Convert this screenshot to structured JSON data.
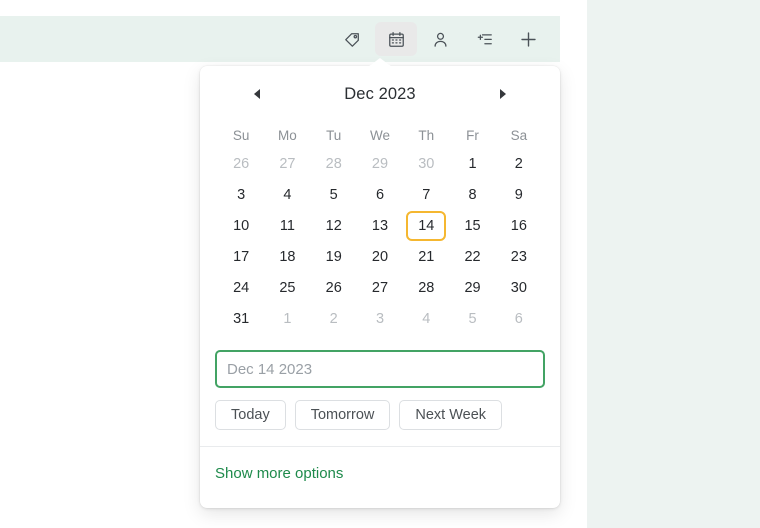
{
  "theme": {
    "toolbar_bg": "#e8f2ee",
    "side_panel_bg": "#edf3f1",
    "popup_bg": "#ffffff",
    "accent_green": "#1e8a4b",
    "input_focus_border": "#43a364",
    "selected_day_border": "#f5b730",
    "icon_color": "#4b5258"
  },
  "toolbar": {
    "buttons": [
      {
        "name": "tag-icon",
        "label": "Tag",
        "active": false
      },
      {
        "name": "calendar-icon",
        "label": "Due date",
        "active": true
      },
      {
        "name": "person-icon",
        "label": "Assign",
        "active": false
      },
      {
        "name": "add-to-list-icon",
        "label": "Add to list",
        "active": false
      },
      {
        "name": "plus-icon",
        "label": "More",
        "active": false
      }
    ]
  },
  "datepicker": {
    "prev_label": "◀",
    "next_label": "▶",
    "title": "Dec 2023",
    "month": "Dec",
    "year": "2023",
    "weekdays": [
      "Su",
      "Mo",
      "Tu",
      "We",
      "Th",
      "Fr",
      "Sa"
    ],
    "selected_day": 14,
    "weeks": [
      [
        {
          "d": "26",
          "muted": true
        },
        {
          "d": "27",
          "muted": true
        },
        {
          "d": "28",
          "muted": true
        },
        {
          "d": "29",
          "muted": true
        },
        {
          "d": "30",
          "muted": true
        },
        {
          "d": "1",
          "muted": false
        },
        {
          "d": "2",
          "muted": false
        }
      ],
      [
        {
          "d": "3",
          "muted": false
        },
        {
          "d": "4",
          "muted": false
        },
        {
          "d": "5",
          "muted": false
        },
        {
          "d": "6",
          "muted": false
        },
        {
          "d": "7",
          "muted": false
        },
        {
          "d": "8",
          "muted": false
        },
        {
          "d": "9",
          "muted": false
        }
      ],
      [
        {
          "d": "10",
          "muted": false
        },
        {
          "d": "11",
          "muted": false
        },
        {
          "d": "12",
          "muted": false
        },
        {
          "d": "13",
          "muted": false
        },
        {
          "d": "14",
          "muted": false,
          "selected": true
        },
        {
          "d": "15",
          "muted": false
        },
        {
          "d": "16",
          "muted": false
        }
      ],
      [
        {
          "d": "17",
          "muted": false
        },
        {
          "d": "18",
          "muted": false
        },
        {
          "d": "19",
          "muted": false
        },
        {
          "d": "20",
          "muted": false
        },
        {
          "d": "21",
          "muted": false
        },
        {
          "d": "22",
          "muted": false
        },
        {
          "d": "23",
          "muted": false
        }
      ],
      [
        {
          "d": "24",
          "muted": false
        },
        {
          "d": "25",
          "muted": false
        },
        {
          "d": "26",
          "muted": false
        },
        {
          "d": "27",
          "muted": false
        },
        {
          "d": "28",
          "muted": false
        },
        {
          "d": "29",
          "muted": false
        },
        {
          "d": "30",
          "muted": false
        }
      ],
      [
        {
          "d": "31",
          "muted": false
        },
        {
          "d": "1",
          "muted": true
        },
        {
          "d": "2",
          "muted": true
        },
        {
          "d": "3",
          "muted": true
        },
        {
          "d": "4",
          "muted": true
        },
        {
          "d": "5",
          "muted": true
        },
        {
          "d": "6",
          "muted": true
        }
      ]
    ],
    "input": {
      "value": "",
      "placeholder": "Dec 14 2023"
    },
    "quick_buttons": [
      {
        "label": "Today"
      },
      {
        "label": "Tomorrow"
      },
      {
        "label": "Next Week"
      }
    ],
    "footer": {
      "more_options_label": "Show more options"
    }
  }
}
